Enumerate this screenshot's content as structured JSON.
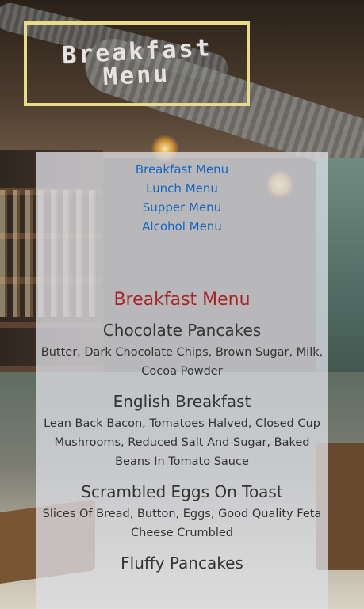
{
  "title": {
    "line1": "Breakfast",
    "line2": "Menu"
  },
  "nav": [
    {
      "label": "Breakfast Menu"
    },
    {
      "label": "Lunch Menu"
    },
    {
      "label": "Supper Menu"
    },
    {
      "label": "Alcohol Menu"
    }
  ],
  "section": {
    "heading": "Breakfast Menu"
  },
  "items": [
    {
      "name": "Chocolate Pancakes",
      "desc": "Butter, Dark Chocolate Chips, Brown Sugar, Milk, Cocoa Powder"
    },
    {
      "name": "English Breakfast",
      "desc": "Lean Back Bacon, Tomatoes Halved, Closed Cup Mushrooms, Reduced Salt And Sugar, Baked Beans In Tomato Sauce"
    },
    {
      "name": "Scrambled Eggs On Toast",
      "desc": "Slices Of Bread, Button, Eggs, Good Quality Feta Cheese Crumbled"
    },
    {
      "name": "Fluffy Pancakes",
      "desc": ""
    }
  ],
  "colors": {
    "link": "#1565c0",
    "heading": "#a62626",
    "title_border": "#e8dc8a"
  }
}
